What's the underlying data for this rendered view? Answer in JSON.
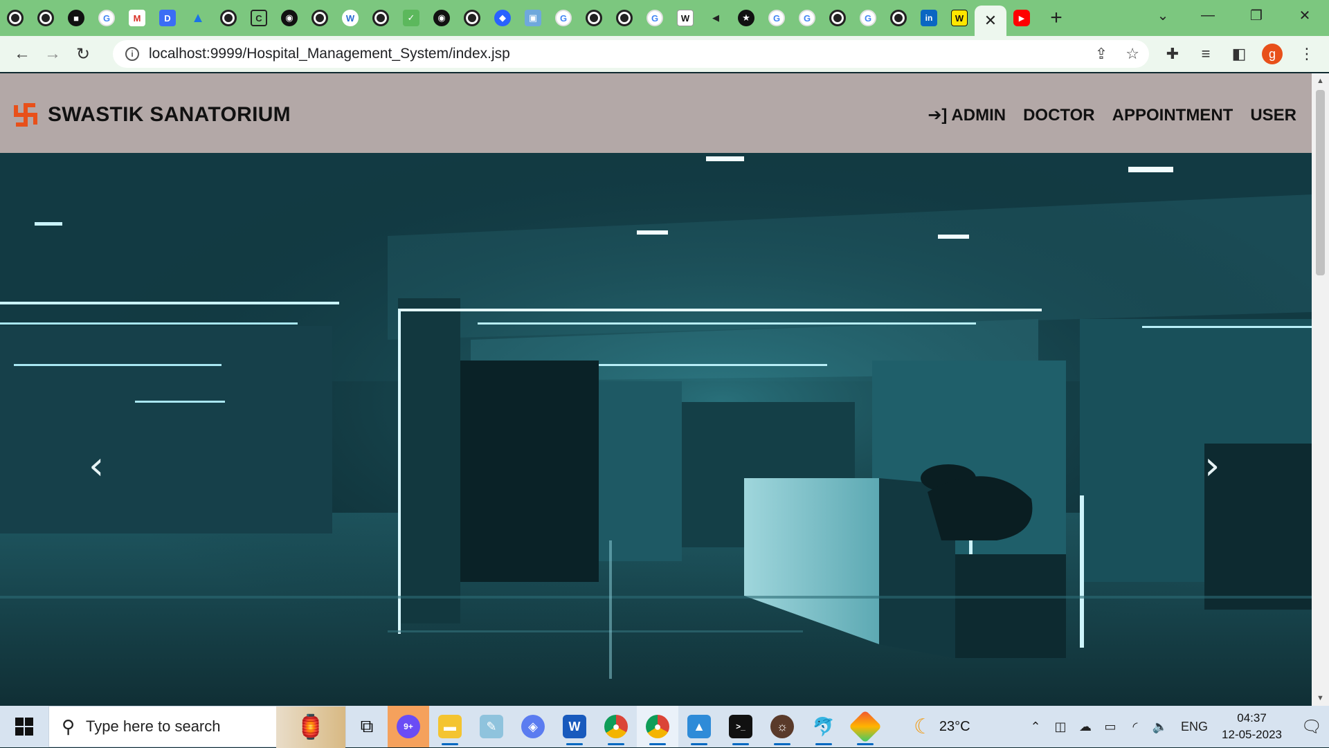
{
  "browser": {
    "url": "localhost:9999/Hospital_Management_System/index.jsp",
    "active_tab_close": "✕",
    "new_tab": "+",
    "profile_initial": "g"
  },
  "site": {
    "brand": "SWASTIK SANATORIUM",
    "nav": [
      {
        "label": "ADMIN",
        "icon": "sign-in-icon"
      },
      {
        "label": "DOCTOR"
      },
      {
        "label": "APPOINTMENT"
      },
      {
        "label": "USER"
      }
    ],
    "carousel": {
      "prev": "‹",
      "next": "›"
    }
  },
  "taskbar": {
    "search_placeholder": "Type here to search",
    "weather_temp": "23°C",
    "language": "ENG",
    "time": "04:37",
    "date": "12-05-2023",
    "badge": "9+"
  },
  "colors": {
    "tabstrip": "#7cc77f",
    "toolbar": "#edf7ee",
    "navbar": "#b3a8a7",
    "brand_logo": "#e8501a"
  }
}
